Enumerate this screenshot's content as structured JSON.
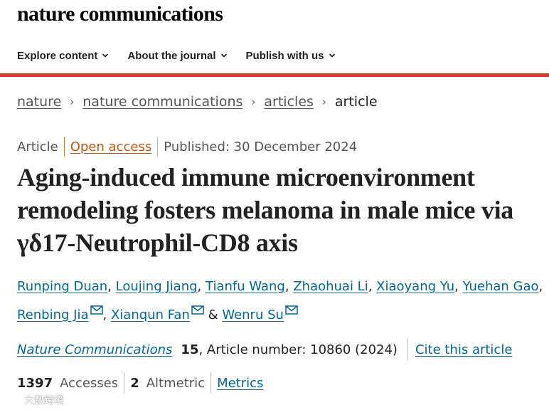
{
  "header": {
    "brand": "nature communications"
  },
  "nav": {
    "items": [
      {
        "label": "Explore content"
      },
      {
        "label": "About the journal"
      },
      {
        "label": "Publish with us"
      }
    ]
  },
  "breadcrumb": {
    "items": [
      "nature",
      "nature communications",
      "articles"
    ],
    "current": "article"
  },
  "article_meta": {
    "type": "Article",
    "open_access": "Open access",
    "published": "Published: 30 December 2024"
  },
  "article": {
    "title": "Aging-induced immune microenvironment remodeling fosters melanoma in male mice via γδ17-Neutrophil-CD8 axis",
    "authors": [
      {
        "name": "Runping Duan",
        "email": false
      },
      {
        "name": "Loujing Jiang",
        "email": false
      },
      {
        "name": "Tianfu Wang",
        "email": false
      },
      {
        "name": "Zhaohuai Li",
        "email": false
      },
      {
        "name": "Xiaoyang Yu",
        "email": false
      },
      {
        "name": "Yuehan Gao",
        "email": false
      },
      {
        "name": "Renbing Jia",
        "email": true
      },
      {
        "name": "Xianqun Fan",
        "email": true
      },
      {
        "name": "Wenru Su",
        "email": true
      }
    ]
  },
  "citation": {
    "journal": "Nature Communications",
    "volume": "15",
    "article_number": ", Article number: 10860 (2024)",
    "cite_label": "Cite this article"
  },
  "metrics": {
    "accesses_value": "1397",
    "accesses_label": "Accesses",
    "altmetric_value": "2",
    "altmetric_label": "Altmetric",
    "metrics_link": "Metrics"
  },
  "watermark": {
    "text": "大数跨境"
  }
}
